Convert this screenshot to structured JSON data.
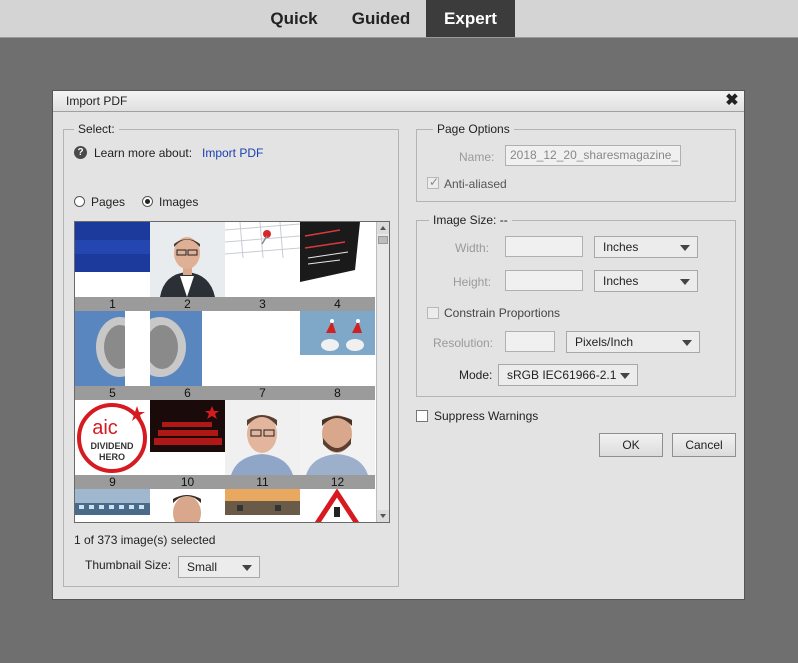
{
  "modebar": {
    "tabs": [
      {
        "label": "Quick",
        "active": false
      },
      {
        "label": "Guided",
        "active": false
      },
      {
        "label": "Expert",
        "active": true
      }
    ]
  },
  "dialog": {
    "title": "Import PDF",
    "close_glyph": "✖",
    "select": {
      "legend": "Select:",
      "learn_more_label": "Learn more about:",
      "learn_more_link": "Import PDF",
      "radio_pages": "Pages",
      "radio_images": "Images",
      "selected_mode": "Images",
      "thumbnails": [
        {
          "number": "1",
          "content": "blue-glitter"
        },
        {
          "number": "2",
          "content": "portrait-man-glasses-suit",
          "selected": true
        },
        {
          "number": "3",
          "content": "calendar-pin"
        },
        {
          "number": "4",
          "content": "stock-screens"
        },
        {
          "number": "5",
          "content": "dollar-portrait-left"
        },
        {
          "number": "6",
          "content": "dollar-portrait-right"
        },
        {
          "number": "7",
          "content": "blank"
        },
        {
          "number": "8",
          "content": "birds-santa-hats"
        },
        {
          "number": "9",
          "content": "aic-dividend-hero-logo"
        },
        {
          "number": "10",
          "content": "red-cinema-seats"
        },
        {
          "number": "11",
          "content": "portrait-man-glasses"
        },
        {
          "number": "12",
          "content": "portrait-man-beard"
        },
        {
          "number": "",
          "content": "building"
        },
        {
          "number": "",
          "content": "portrait-man"
        },
        {
          "number": "",
          "content": "sunset-road"
        },
        {
          "number": "",
          "content": "warning-sign"
        }
      ],
      "logo_text": {
        "line1": "aic",
        "line2": "DIVIDEND",
        "line3": "HERO"
      },
      "status": "1 of 373 image(s) selected",
      "thumb_size_label": "Thumbnail Size:",
      "thumb_size_value": "Small"
    },
    "page_options": {
      "legend": "Page Options",
      "name_label": "Name:",
      "name_value": "2018_12_20_sharesmagazine_",
      "antialiased_label": "Anti-aliased",
      "antialiased_checked": true
    },
    "image_size": {
      "legend": "Image Size: --",
      "width_label": "Width:",
      "width_unit": "Inches",
      "height_label": "Height:",
      "height_unit": "Inches",
      "constrain_label": "Constrain Proportions",
      "resolution_label": "Resolution:",
      "resolution_unit": "Pixels/Inch",
      "mode_label": "Mode:",
      "mode_value": "sRGB IEC61966-2.1"
    },
    "suppress_label": "Suppress Warnings",
    "ok_label": "OK",
    "cancel_label": "Cancel"
  }
}
